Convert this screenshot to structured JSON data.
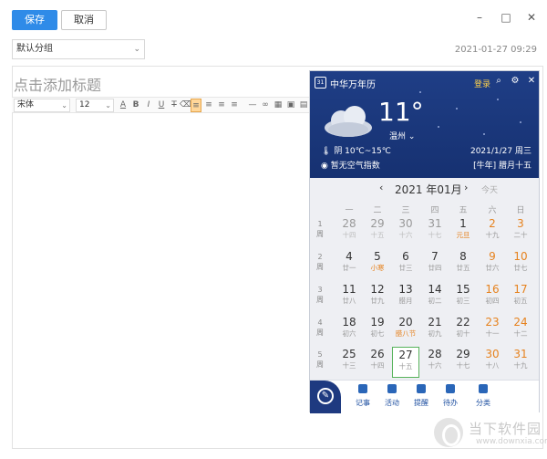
{
  "editor": {
    "save_label": "保存",
    "cancel_label": "取消",
    "group_select": "默认分组",
    "datetime": "2021-01-27 09:29",
    "title_placeholder": "点击添加标题",
    "font_family": "宋体",
    "font_size": "12",
    "window_controls": {
      "minimize": "–",
      "maximize": "□",
      "close": "✕"
    }
  },
  "calendar": {
    "app_title": "中华万年历",
    "login": "登录",
    "weather": {
      "temperature": "11°",
      "city": "温州",
      "condition": "阴 10℃~15℃",
      "air_quality": "暂无空气指数"
    },
    "date_line": "2021/1/27 周三",
    "lunar_line": "[牛年] 腊月十五",
    "month_label": "2021 年01月",
    "today_label": "今天",
    "weekdays": [
      "一",
      "二",
      "三",
      "四",
      "五",
      "六",
      "日"
    ],
    "weeks": [
      {
        "num": "1",
        "suffix": "周",
        "days": [
          {
            "n": "28",
            "l": "十四",
            "dim": true
          },
          {
            "n": "29",
            "l": "十五",
            "dim": true
          },
          {
            "n": "30",
            "l": "十六",
            "dim": true
          },
          {
            "n": "31",
            "l": "十七",
            "dim": true
          },
          {
            "n": "1",
            "l": "元旦",
            "hol": true
          },
          {
            "n": "2",
            "l": "十九",
            "we": true
          },
          {
            "n": "3",
            "l": "二十",
            "we": true
          }
        ]
      },
      {
        "num": "2",
        "suffix": "周",
        "days": [
          {
            "n": "4",
            "l": "廿一"
          },
          {
            "n": "5",
            "l": "小寒",
            "hol": true
          },
          {
            "n": "6",
            "l": "廿三"
          },
          {
            "n": "7",
            "l": "廿四"
          },
          {
            "n": "8",
            "l": "廿五"
          },
          {
            "n": "9",
            "l": "廿六",
            "we": true
          },
          {
            "n": "10",
            "l": "廿七",
            "we": true
          }
        ]
      },
      {
        "num": "3",
        "suffix": "周",
        "days": [
          {
            "n": "11",
            "l": "廿八"
          },
          {
            "n": "12",
            "l": "廿九"
          },
          {
            "n": "13",
            "l": "腊月"
          },
          {
            "n": "14",
            "l": "初二"
          },
          {
            "n": "15",
            "l": "初三"
          },
          {
            "n": "16",
            "l": "初四",
            "we": true
          },
          {
            "n": "17",
            "l": "初五",
            "we": true
          }
        ]
      },
      {
        "num": "4",
        "suffix": "周",
        "days": [
          {
            "n": "18",
            "l": "初六"
          },
          {
            "n": "19",
            "l": "初七"
          },
          {
            "n": "20",
            "l": "腊八节",
            "hol": true
          },
          {
            "n": "21",
            "l": "初九"
          },
          {
            "n": "22",
            "l": "初十"
          },
          {
            "n": "23",
            "l": "十一",
            "we": true
          },
          {
            "n": "24",
            "l": "十二",
            "we": true
          }
        ]
      },
      {
        "num": "5",
        "suffix": "周",
        "days": [
          {
            "n": "25",
            "l": "十三"
          },
          {
            "n": "26",
            "l": "十四"
          },
          {
            "n": "27",
            "l": "十五",
            "today": true
          },
          {
            "n": "28",
            "l": "十六"
          },
          {
            "n": "29",
            "l": "十七"
          },
          {
            "n": "30",
            "l": "十八",
            "we": true
          },
          {
            "n": "31",
            "l": "十九",
            "we": true
          }
        ]
      }
    ],
    "footer": [
      {
        "label": "记事",
        "icon": "note-icon"
      },
      {
        "label": "活动",
        "icon": "activity-icon"
      },
      {
        "label": "提醒",
        "icon": "bell-icon"
      },
      {
        "label": "待办",
        "icon": "todo-icon"
      },
      {
        "label": "分类",
        "icon": "folder-icon"
      }
    ]
  },
  "watermark": {
    "text": "当下软件园",
    "url": "www.downxia.com"
  },
  "colors": {
    "accent": "#2f8be8",
    "calendar_header": "#1f3e86",
    "weekend": "#e6821e",
    "today_border": "#57b35b"
  }
}
